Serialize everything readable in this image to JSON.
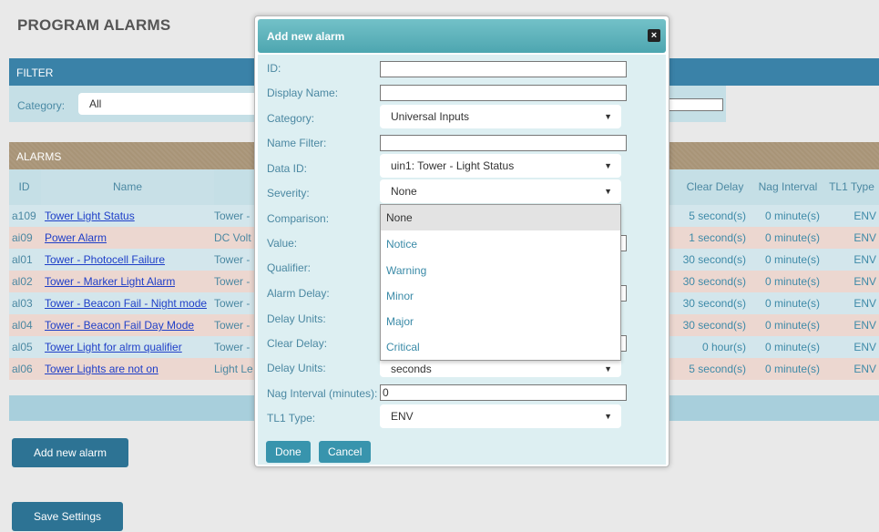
{
  "page_title": "PROGRAM ALARMS",
  "filter": {
    "header": "FILTER",
    "category_label": "Category:",
    "category_value": "All"
  },
  "alarms": {
    "header": "ALARMS",
    "columns": {
      "id": "ID",
      "name": "Name",
      "clear_delay": "Clear Delay",
      "nag_interval": "Nag Interval",
      "tl1_type": "TL1 Type"
    },
    "rows": [
      {
        "id": "a109",
        "name": "Tower Light Status",
        "desc": "Tower -",
        "clear_delay": "5 second(s)",
        "nag_interval": "0 minute(s)",
        "tl1_type": "ENV"
      },
      {
        "id": "ai09",
        "name": "Power Alarm",
        "desc": "DC Volt",
        "clear_delay": "1 second(s)",
        "nag_interval": "0 minute(s)",
        "tl1_type": "ENV"
      },
      {
        "id": "al01",
        "name": "Tower - Photocell Failure",
        "desc": "Tower -",
        "clear_delay": "30 second(s)",
        "nag_interval": "0 minute(s)",
        "tl1_type": "ENV"
      },
      {
        "id": "al02",
        "name": "Tower - Marker Light Alarm",
        "desc": "Tower -",
        "clear_delay": "30 second(s)",
        "nag_interval": "0 minute(s)",
        "tl1_type": "ENV"
      },
      {
        "id": "al03",
        "name": "Tower - Beacon Fail - Night mode",
        "desc": "Tower -",
        "clear_delay": "30 second(s)",
        "nag_interval": "0 minute(s)",
        "tl1_type": "ENV"
      },
      {
        "id": "al04",
        "name": "Tower - Beacon Fail Day Mode",
        "desc": "Tower -",
        "clear_delay": "30 second(s)",
        "nag_interval": "0 minute(s)",
        "tl1_type": "ENV"
      },
      {
        "id": "al05",
        "name": "Tower Light for alrm qualifier",
        "desc": "Tower -",
        "clear_delay": "0 hour(s)",
        "nag_interval": "0 minute(s)",
        "tl1_type": "ENV"
      },
      {
        "id": "al06",
        "name": "Tower Lights are not on",
        "desc": "Light Le",
        "clear_delay": "5 second(s)",
        "nag_interval": "0 minute(s)",
        "tl1_type": "ENV"
      }
    ]
  },
  "buttons": {
    "add_new_alarm": "Add new alarm",
    "save_settings": "Save Settings"
  },
  "modal": {
    "title": "Add new alarm",
    "close": "×",
    "labels": {
      "id": "ID:",
      "display_name": "Display Name:",
      "category": "Category:",
      "name_filter": "Name Filter:",
      "data_id": "Data ID:",
      "severity": "Severity:",
      "comparison": "Comparison:",
      "value": "Value:",
      "qualifier": "Qualifier:",
      "alarm_delay": "Alarm Delay:",
      "delay_units": "Delay Units:",
      "clear_delay": "Clear Delay:",
      "delay_units_2": "Delay Units:",
      "nag_interval": "Nag Interval (minutes):",
      "tl1_type": "TL1 Type:"
    },
    "values": {
      "id": "",
      "display_name": "",
      "category": "Universal Inputs",
      "name_filter": "",
      "data_id": "uin1: Tower - Light Status",
      "severity": "None",
      "delay_units_2": "seconds",
      "nag_interval": "0",
      "tl1_type": "ENV"
    },
    "severity_options": [
      "None",
      "Notice",
      "Warning",
      "Minor",
      "Major",
      "Critical"
    ],
    "done": "Done",
    "cancel": "Cancel"
  }
}
